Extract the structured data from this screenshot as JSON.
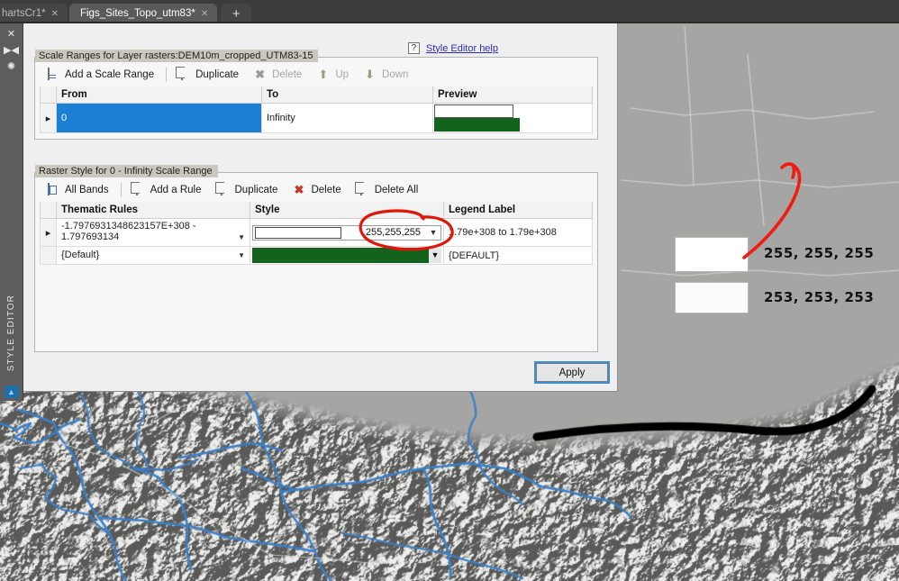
{
  "window": {
    "tabs": [
      {
        "label": "hartsCr1*",
        "close_icon": "close-icon",
        "active": false
      },
      {
        "label": "Figs_Sites_Topo_utm83*",
        "close_icon": "close-icon",
        "active": true
      }
    ],
    "new_tab_label": "+"
  },
  "dock": {
    "label": "STYLE EDITOR",
    "icons": [
      "close-icon",
      "pin-icon",
      "settings-icon"
    ],
    "logo_icon": "app-logo-icon"
  },
  "help": {
    "question_icon": "?",
    "link_label": "Style Editor help"
  },
  "scale_ranges": {
    "title": "Scale Ranges for Layer rasters:DEM10m_cropped_UTM83-15",
    "toolbar": [
      {
        "label": "Add a Scale Range",
        "icon": "add-scale-range-icon",
        "enabled": true
      },
      {
        "label": "Duplicate",
        "icon": "duplicate-icon",
        "enabled": true
      },
      {
        "label": "Delete",
        "icon": "delete-x-icon",
        "enabled": false
      },
      {
        "label": "Up",
        "icon": "arrow-up-icon",
        "enabled": false
      },
      {
        "label": "Down",
        "icon": "arrow-down-icon",
        "enabled": false
      }
    ],
    "columns": [
      "From",
      "To",
      "Preview"
    ],
    "rows": [
      {
        "selector": "▸",
        "from": "0",
        "to": "Infinity",
        "preview_colors": [
          "#ffffff",
          "#14631c"
        ],
        "selected": true
      }
    ]
  },
  "raster_style": {
    "title": "Raster Style for 0 - Infinity Scale Range",
    "toolbar": [
      {
        "label": "All Bands",
        "icon": "all-bands-icon",
        "enabled": true
      },
      {
        "label": "Add a Rule",
        "icon": "add-rule-icon",
        "enabled": true
      },
      {
        "label": "Duplicate",
        "icon": "duplicate-icon",
        "enabled": true
      },
      {
        "label": "Delete",
        "icon": "delete-x-icon",
        "enabled": true
      },
      {
        "label": "Delete All",
        "icon": "delete-all-icon",
        "enabled": true
      }
    ],
    "columns": [
      "Thematic Rules",
      "Style",
      "Legend Label"
    ],
    "rows": [
      {
        "selector": "▸",
        "rule": "-1.7976931348623157E+308 - 1.797693134",
        "style_value": "255,255,255",
        "style_color": "#ffffff",
        "legend_label": "1.79e+308 to 1.79e+308"
      },
      {
        "selector": "",
        "rule": "{Default}",
        "style_value": "",
        "style_color": "#14631c",
        "legend_label": "{DEFAULT}"
      }
    ]
  },
  "actions": {
    "apply_label": "Apply"
  },
  "annotations": {
    "arrow_color": "#f01c10",
    "ellipse_color": "#e01608",
    "callouts": [
      {
        "label": "255, 255, 255",
        "swatch_color": "#ffffff"
      },
      {
        "label": "253, 253, 253",
        "swatch_color": "#fbfbfb"
      }
    ]
  },
  "map": {
    "terrain_base": "#a0a0a0",
    "stream_color": "#3a80c8",
    "road_color": "#000000"
  }
}
